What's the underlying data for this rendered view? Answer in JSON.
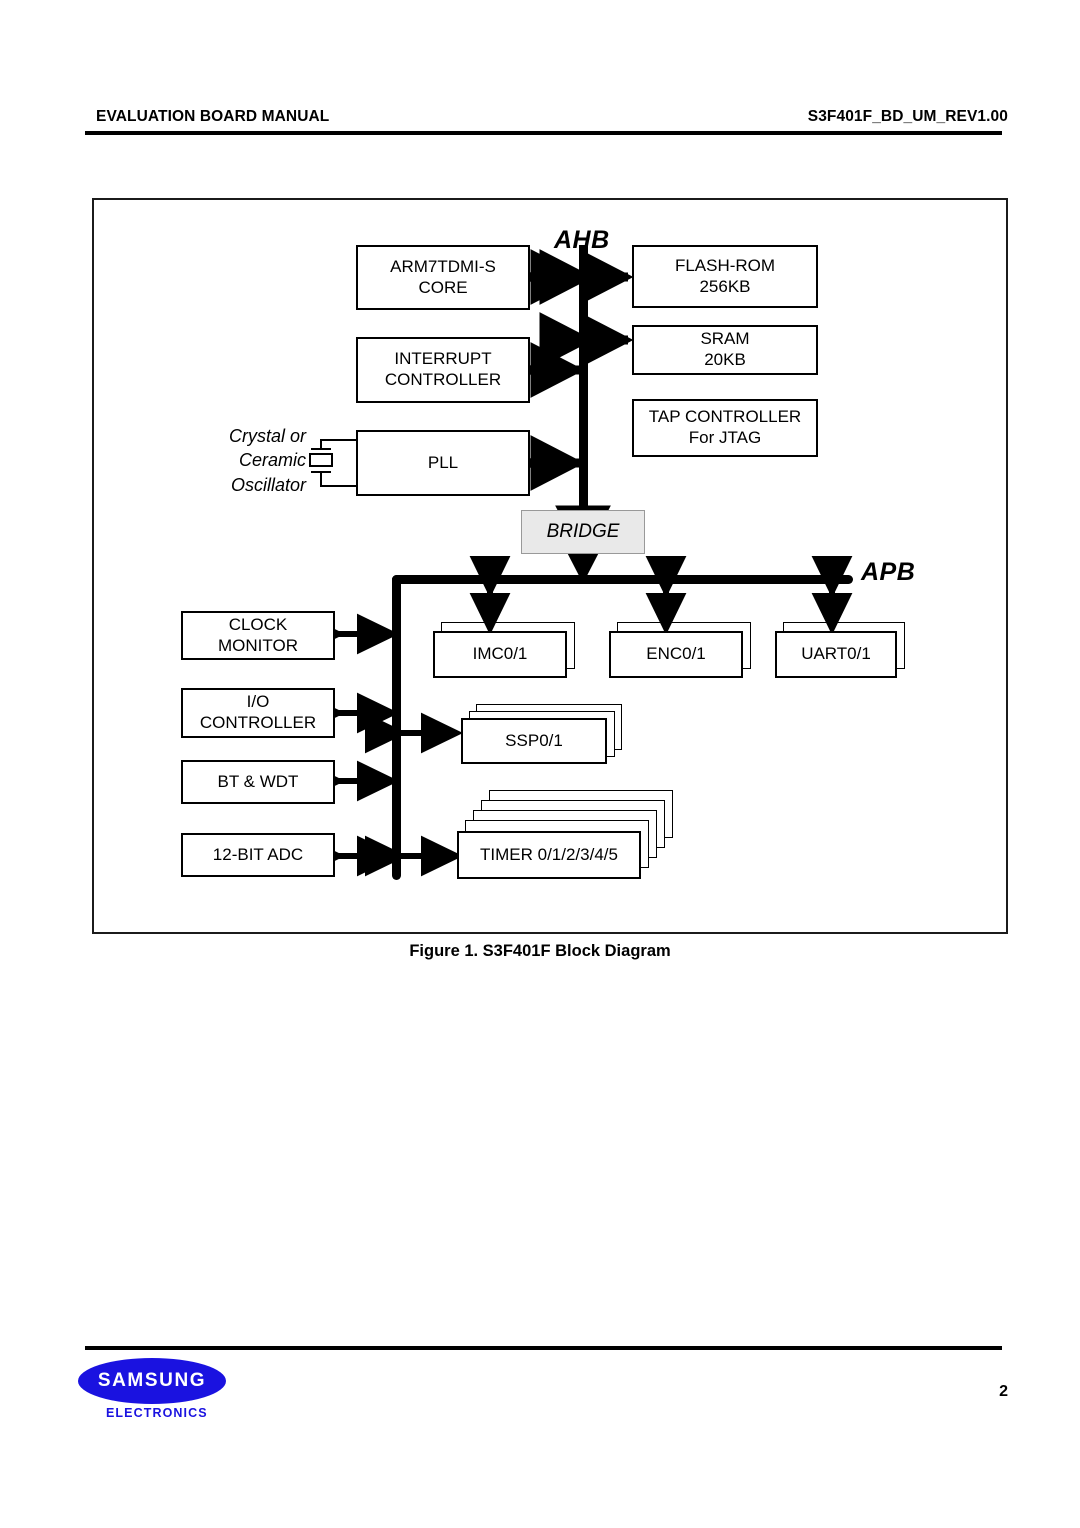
{
  "header": {
    "left_title": "EVALUATION BOARD MANUAL",
    "right_title": "S3F401F_BD_UM_REV1.00"
  },
  "figure": {
    "caption": "Figure 1. S3F401F Block Diagram"
  },
  "diagram": {
    "bus_labels": {
      "ahb": "AHB",
      "apb": "APB"
    },
    "bridge_label": "BRIDGE",
    "oscillator_label": "Crystal or\nCeramic\nOscillator",
    "ahb_left_blocks": [
      {
        "label": "ARM7TDMI-S\nCORE"
      },
      {
        "label": "INTERRUPT\nCONTROLLER"
      },
      {
        "label": "PLL"
      }
    ],
    "ahb_right_blocks": [
      {
        "label": "FLASH-ROM\n256KB"
      },
      {
        "label": "SRAM\n20KB"
      },
      {
        "label": "TAP CONTROLLER\nFor JTAG"
      }
    ],
    "apb_left_blocks": [
      {
        "label": "CLOCK\nMONITOR"
      },
      {
        "label": "I/O\nCONTROLLER"
      },
      {
        "label": "BT & WDT"
      },
      {
        "label": "12-BIT ADC"
      }
    ],
    "apb_right_blocks": [
      {
        "label": "IMC0/1",
        "stack": 1
      },
      {
        "label": "ENC0/1",
        "stack": 1
      },
      {
        "label": "UART0/1",
        "stack": 1
      },
      {
        "label": "SSP0/1",
        "stack": 2
      },
      {
        "label": "TIMER 0/1/2/3/4/5",
        "stack": 4
      }
    ]
  },
  "footer": {
    "brand": "SAMSUNG",
    "brand_sub": "ELECTRONICS",
    "page_number": "2",
    "brand_color": "#1a12e0"
  }
}
